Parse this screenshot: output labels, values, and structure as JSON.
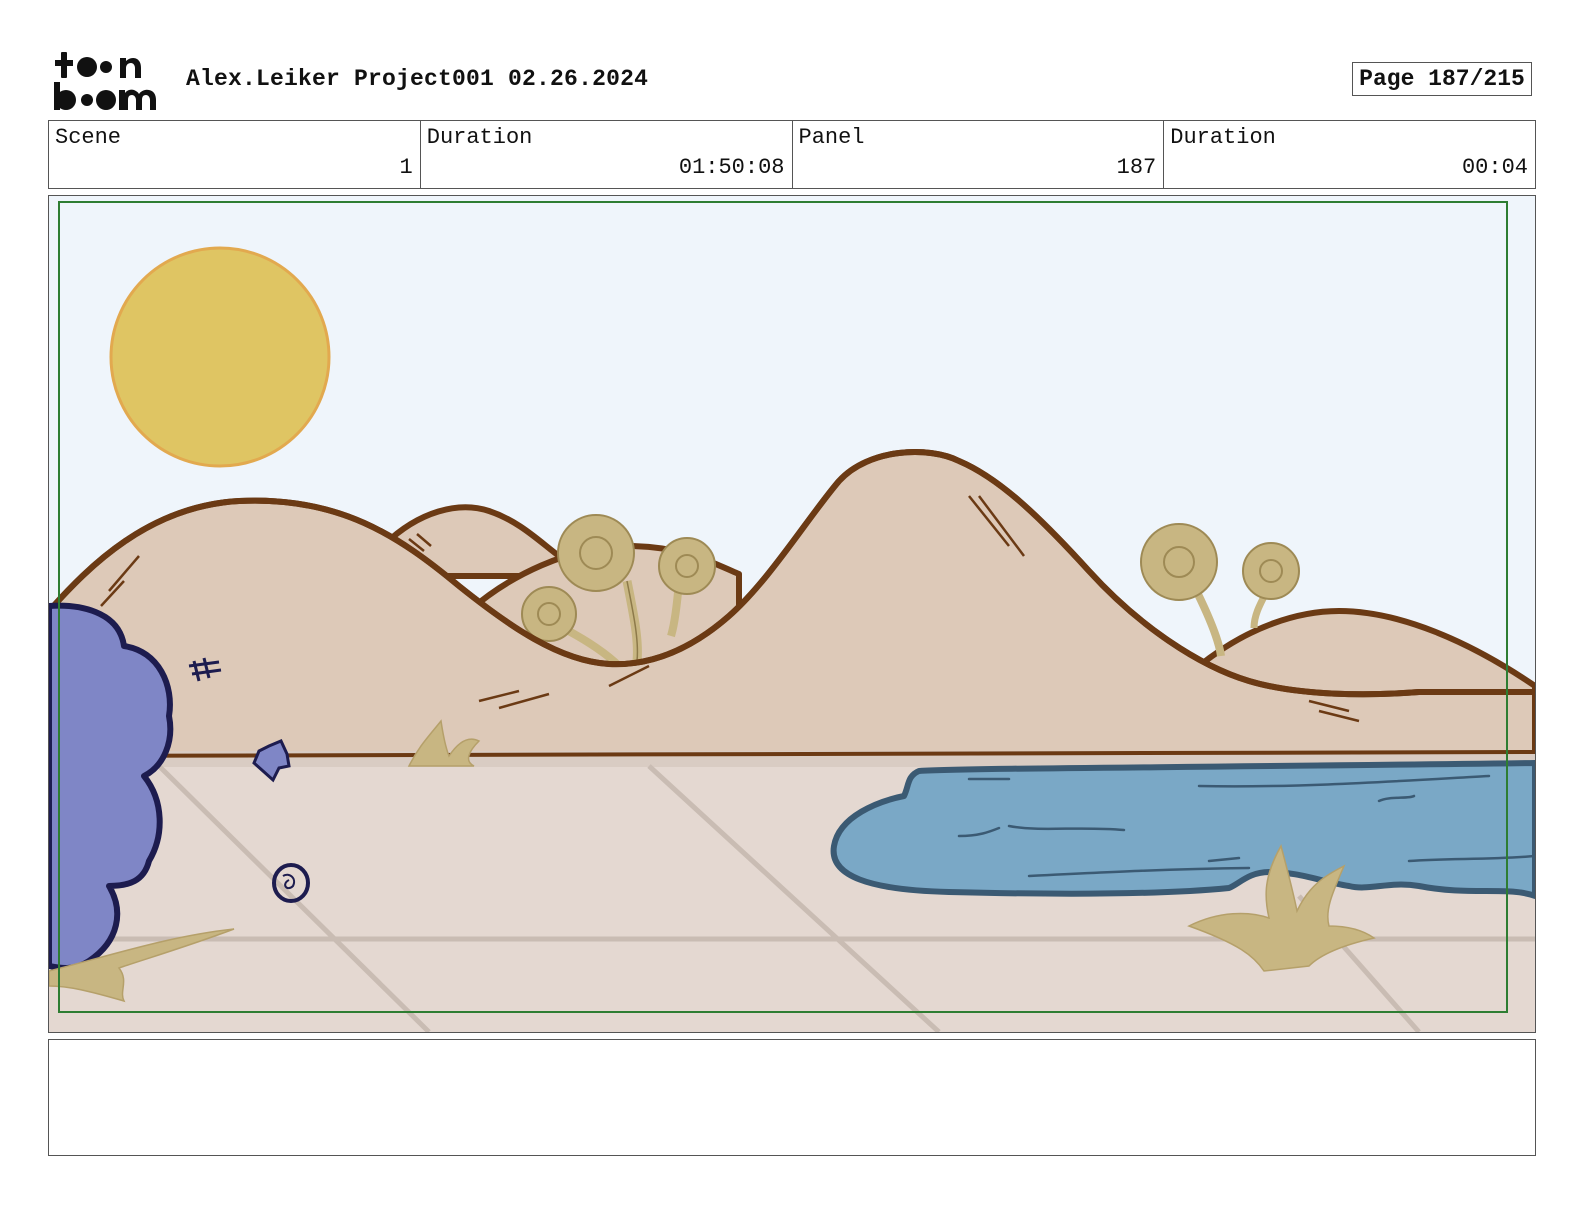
{
  "header": {
    "logo_text": "toon boom",
    "project_title": "Alex.Leiker Project001 02.26.2024",
    "page_label": "Page 187/215"
  },
  "info": [
    {
      "label": "Scene",
      "value": "1"
    },
    {
      "label": "Duration",
      "value": "01:50:08"
    },
    {
      "label": "Panel",
      "value": "187"
    },
    {
      "label": "Duration",
      "value": "00:04"
    }
  ],
  "panel": {
    "description": "",
    "colors": {
      "sky": "#eff5fb",
      "sun": "#dfc563",
      "sun_outline": "#e2a94f",
      "hills": "#ddc9b8",
      "hill_outline": "#6b3a14",
      "ground": "#e4d8d1",
      "water": "#7aa8c6",
      "water_outline": "#3b5a73",
      "bush": "#7f86c6",
      "bush_outline": "#1d1c4f",
      "plants": "#c8b682",
      "safe_frame": "#2e7d32"
    }
  },
  "notes": {
    "text": ""
  }
}
